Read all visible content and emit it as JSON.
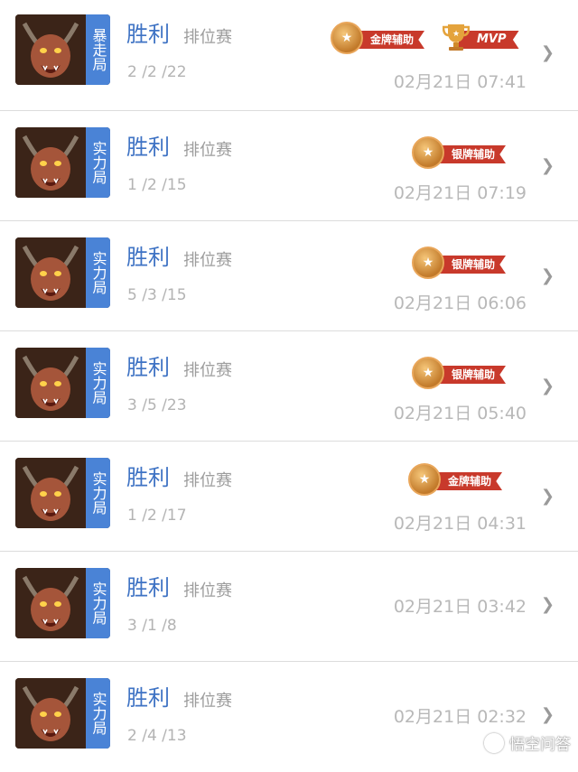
{
  "matches": [
    {
      "mode": "暴走局",
      "result": "胜利",
      "type": "排位赛",
      "kda": "2 /2 /22",
      "time": "02月21日 07:41",
      "badge": "金牌辅助",
      "mvp": "MVP"
    },
    {
      "mode": "实力局",
      "result": "胜利",
      "type": "排位赛",
      "kda": "1 /2 /15",
      "time": "02月21日 07:19",
      "badge": "银牌辅助",
      "mvp": null
    },
    {
      "mode": "实力局",
      "result": "胜利",
      "type": "排位赛",
      "kda": "5 /3 /15",
      "time": "02月21日 06:06",
      "badge": "银牌辅助",
      "mvp": null
    },
    {
      "mode": "实力局",
      "result": "胜利",
      "type": "排位赛",
      "kda": "3 /5 /23",
      "time": "02月21日 05:40",
      "badge": "银牌辅助",
      "mvp": null
    },
    {
      "mode": "实力局",
      "result": "胜利",
      "type": "排位赛",
      "kda": "1 /2 /17",
      "time": "02月21日 04:31",
      "badge": "金牌辅助",
      "mvp": null
    },
    {
      "mode": "实力局",
      "result": "胜利",
      "type": "排位赛",
      "kda": "3 /1 /8",
      "time": "02月21日 03:42",
      "badge": null,
      "mvp": null
    },
    {
      "mode": "实力局",
      "result": "胜利",
      "type": "排位赛",
      "kda": "2 /4 /13",
      "time": "02月21日 02:32",
      "badge": null,
      "mvp": null
    }
  ],
  "watermark": "悟空问答",
  "colors": {
    "mode_tag": "#4a83d6",
    "result": "#3f73c4",
    "ribbon": "#c8392b",
    "medal": "#c27a2a"
  },
  "icons": {
    "chevron": "chevron-right-icon",
    "medal": "star-medal-icon",
    "mvp": "trophy-icon"
  }
}
